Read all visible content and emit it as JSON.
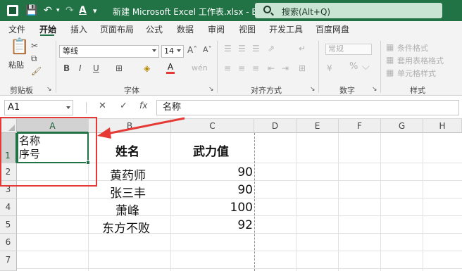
{
  "titlebar": {
    "title": "新建 Microsoft Excel 工作表.xlsx  -  Excel",
    "search_placeholder": "搜索(Alt+Q)"
  },
  "tabs": [
    "文件",
    "开始",
    "插入",
    "页面布局",
    "公式",
    "数据",
    "审阅",
    "视图",
    "开发工具",
    "百度网盘"
  ],
  "active_tab": "开始",
  "ribbon": {
    "paste_label": "粘贴",
    "font_name": "等线",
    "font_size": "14",
    "number_format": "常规",
    "cond_format": "条件格式",
    "table_format": "套用表格格式",
    "cell_style": "单元格样式",
    "groups": {
      "clipboard": "剪贴板",
      "font": "字体",
      "align": "对齐方式",
      "number": "数字",
      "style": "样式"
    }
  },
  "formula_bar": {
    "name_box": "A1",
    "fx": "fx",
    "content": "名称"
  },
  "sheet": {
    "columns": [
      "A",
      "B",
      "C",
      "D",
      "E",
      "F",
      "G",
      "H"
    ],
    "rows": [
      "1",
      "2",
      "3",
      "4",
      "5",
      "6",
      "7"
    ],
    "selected_cell": "A1",
    "a1_line1": "名称",
    "a1_line2": "序号",
    "headers": {
      "b": "姓名",
      "c": "武力值"
    },
    "data": [
      {
        "name": "黄药师",
        "value": "90"
      },
      {
        "name": "张三丰",
        "value": "90"
      },
      {
        "name": "萧峰",
        "value": "100"
      },
      {
        "name": "东方不败",
        "value": "92"
      }
    ]
  },
  "annotation_color": "#e53935",
  "accent_color": "#217346"
}
